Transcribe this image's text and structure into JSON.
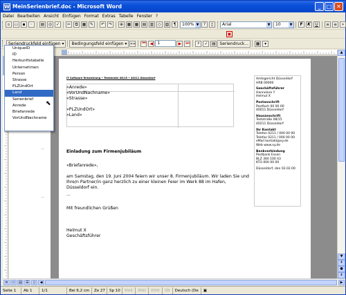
{
  "window": {
    "title": "MeinSerienbrief.doc - Microsoft Word",
    "minimize": "_",
    "maximize": "□",
    "close": "✕"
  },
  "menu": [
    "Datei",
    "Bearbeiten",
    "Ansicht",
    "Einfügen",
    "Format",
    "Extras",
    "Tabelle",
    "Fenster",
    "?"
  ],
  "format_toolbar": {
    "zoom": "100%",
    "font": "Arial",
    "size": "10",
    "bold": "F",
    "italic": "K",
    "underline": "U"
  },
  "mailmerge_toolbar": {
    "insert_field": "Seriendruckfeld einfügen",
    "condition_field": "Bedingungsfeld einfügen",
    "record": "1",
    "merge": "Seriendruck..."
  },
  "dropdown": {
    "items": [
      "UniqueID",
      "ID",
      "Herkunftstabelle",
      "Unternehmen",
      "Person",
      "Strasse",
      "PLZUndOrt",
      "Land",
      "Serienbrief",
      "Anrede",
      "Briefanrede",
      "VorUndNachname"
    ],
    "selected": "Land"
  },
  "document": {
    "sender_line": "IT Software Entwicklung • Teststraße 08/15 • 40211 Düsseldorf",
    "address": [
      "«Anrede»",
      "«VorUndNachname»",
      "«Strasse»",
      "",
      "«PLZUndOrt»",
      "«Land»"
    ],
    "right_column": [
      {
        "text": "Amtsgericht Düsseldorf",
        "bold": false
      },
      {
        "text": "HRB 00000",
        "bold": false
      },
      {
        "text": "",
        "bold": false
      },
      {
        "text": "Geschäftsführer",
        "bold": true
      },
      {
        "text": "Hannelore Y",
        "bold": false
      },
      {
        "text": "Helmut X",
        "bold": false
      },
      {
        "text": "",
        "bold": false
      },
      {
        "text": "Postanschrift",
        "bold": true
      },
      {
        "text": "Postfach 00 00 00",
        "bold": false
      },
      {
        "text": "40011 Düsseldorf",
        "bold": false
      },
      {
        "text": "",
        "bold": false
      },
      {
        "text": "Hausanschrift",
        "bold": true
      },
      {
        "text": "Teststraße 08/15",
        "bold": false
      },
      {
        "text": "40211 Düsseldorf",
        "bold": false
      },
      {
        "text": "",
        "bold": false
      },
      {
        "text": "Ihr Kontakt",
        "bold": true
      },
      {
        "text": "Telefon   0211 / 000 00 00",
        "bold": false
      },
      {
        "text": "Telefax   0211 / 000 00 00",
        "bold": false
      },
      {
        "text": "eMail     kontakt@xy.de",
        "bold": false
      },
      {
        "text": "Web       www.xy.de",
        "bold": false
      },
      {
        "text": "",
        "bold": false
      },
      {
        "text": "Bankverbindung",
        "bold": true
      },
      {
        "text": "Postbank Essen",
        "bold": false
      },
      {
        "text": "BLZ 360 100 43",
        "bold": false
      },
      {
        "text": "KTO 000 00 00",
        "bold": false
      },
      {
        "text": "",
        "bold": false
      },
      {
        "text": "Düsseldorf, den 02.02.00",
        "bold": false
      }
    ],
    "subject": "Einladung zum Firmenjubiläum",
    "salutation": "«Briefanrede»,",
    "body": "am Samstag, den 19. Juni 2004 feiern wir unser 8. Firmenjubiläum. Wir laden Sie und Ihre/n Partner/in ganz herzlich zu einer kleinen Feier im Werk 88 im Hafen, Düsseldorf ein.",
    "dots": "...",
    "closing": "Mit freundlichen Grüßen",
    "signer_name": "Helmut X",
    "signer_title": "Geschäftsführer"
  },
  "status": {
    "page": "Seite 1",
    "section": "Ab 1",
    "pages": "1/1",
    "position": "Bei 6,2 cm",
    "line": "Ze 27",
    "col": "Sp 10",
    "mak": "MAK",
    "aend": "ÄND",
    "erw": "ERW",
    "ub": "ÜB",
    "language": "Deutsch (De"
  }
}
